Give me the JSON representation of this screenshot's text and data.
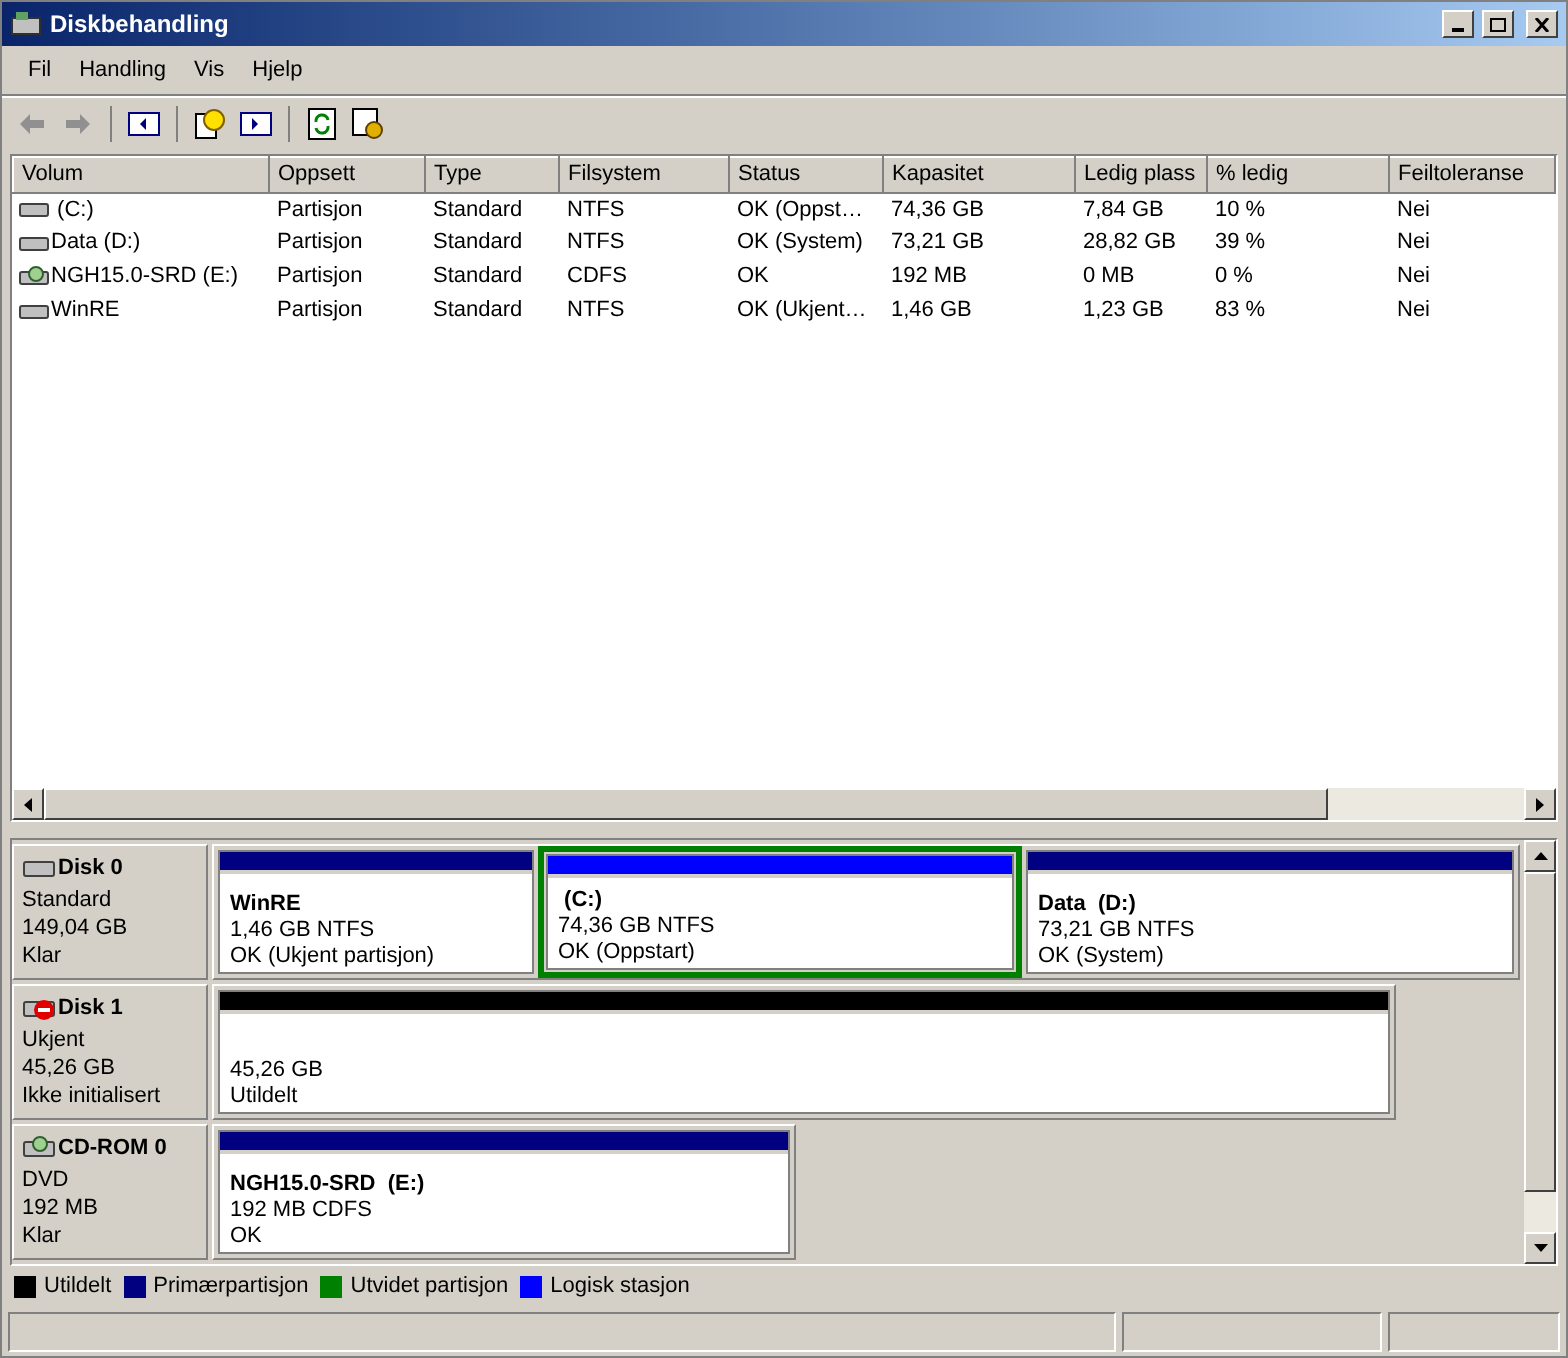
{
  "window": {
    "title": "Diskbehandling"
  },
  "menu": [
    "Fil",
    "Handling",
    "Vis",
    "Hjelp"
  ],
  "volume_list": {
    "columns": [
      "Volum",
      "Oppsett",
      "Type",
      "Filsystem",
      "Status",
      "Kapasitet",
      "Ledig plass",
      "% ledig",
      "Feiltoleranse"
    ],
    "rows": [
      {
        "kind": "disk",
        "cells": [
          " (C:)",
          "Partisjon",
          "Standard",
          "NTFS",
          "OK (Oppst…",
          "74,36 GB",
          "7,84 GB",
          "10 %",
          "Nei"
        ]
      },
      {
        "kind": "disk",
        "cells": [
          "Data (D:)",
          "Partisjon",
          "Standard",
          "NTFS",
          "OK (System)",
          "73,21 GB",
          "28,82 GB",
          "39 %",
          "Nei"
        ]
      },
      {
        "kind": "cdrom",
        "cells": [
          "NGH15.0-SRD (E:)",
          "Partisjon",
          "Standard",
          "CDFS",
          "OK",
          "192 MB",
          "0 MB",
          "0 %",
          "Nei"
        ]
      },
      {
        "kind": "disk",
        "cells": [
          "WinRE",
          "Partisjon",
          "Standard",
          "NTFS",
          "OK (Ukjent…",
          "1,46 GB",
          "1,23 GB",
          "83 %",
          "Nei"
        ]
      }
    ]
  },
  "disks": [
    {
      "kind": "disk",
      "name": "Disk 0",
      "info": [
        "Standard",
        "149,04 GB",
        "Klar"
      ],
      "partitions": [
        {
          "kind": "primary",
          "in_extended": false,
          "name": "WinRE",
          "lines": [
            "1,46 GB NTFS",
            "OK (Ukjent partisjon)"
          ]
        },
        {
          "kind": "logical",
          "in_extended": true,
          "name": " (C:)",
          "lines": [
            "74,36 GB NTFS",
            "OK (Oppstart)"
          ]
        },
        {
          "kind": "primary",
          "in_extended": false,
          "name": "Data  (D:)",
          "lines": [
            "73,21 GB NTFS",
            "OK (System)"
          ]
        }
      ]
    },
    {
      "kind": "disk-error",
      "name": "Disk 1",
      "info": [
        "Ukjent",
        "45,26 GB",
        "Ikke initialisert"
      ],
      "partitions": [
        {
          "kind": "unallocated",
          "in_extended": false,
          "lines": [
            "45,26 GB",
            "Utildelt"
          ]
        }
      ]
    },
    {
      "kind": "cdrom",
      "name": "CD-ROM 0",
      "info": [
        "DVD",
        "192 MB",
        "Klar"
      ],
      "partitions": [
        {
          "kind": "primary",
          "in_extended": false,
          "name": "NGH15.0-SRD  (E:)",
          "lines": [
            "192 MB CDFS",
            "OK"
          ]
        }
      ]
    }
  ],
  "legend": [
    {
      "label": "Utildelt",
      "color": "#000000"
    },
    {
      "label": "Primærpartisjon",
      "color": "#000080"
    },
    {
      "label": "Utvidet partisjon",
      "color": "#008000"
    },
    {
      "label": "Logisk stasjon",
      "color": "#0000ff"
    }
  ]
}
